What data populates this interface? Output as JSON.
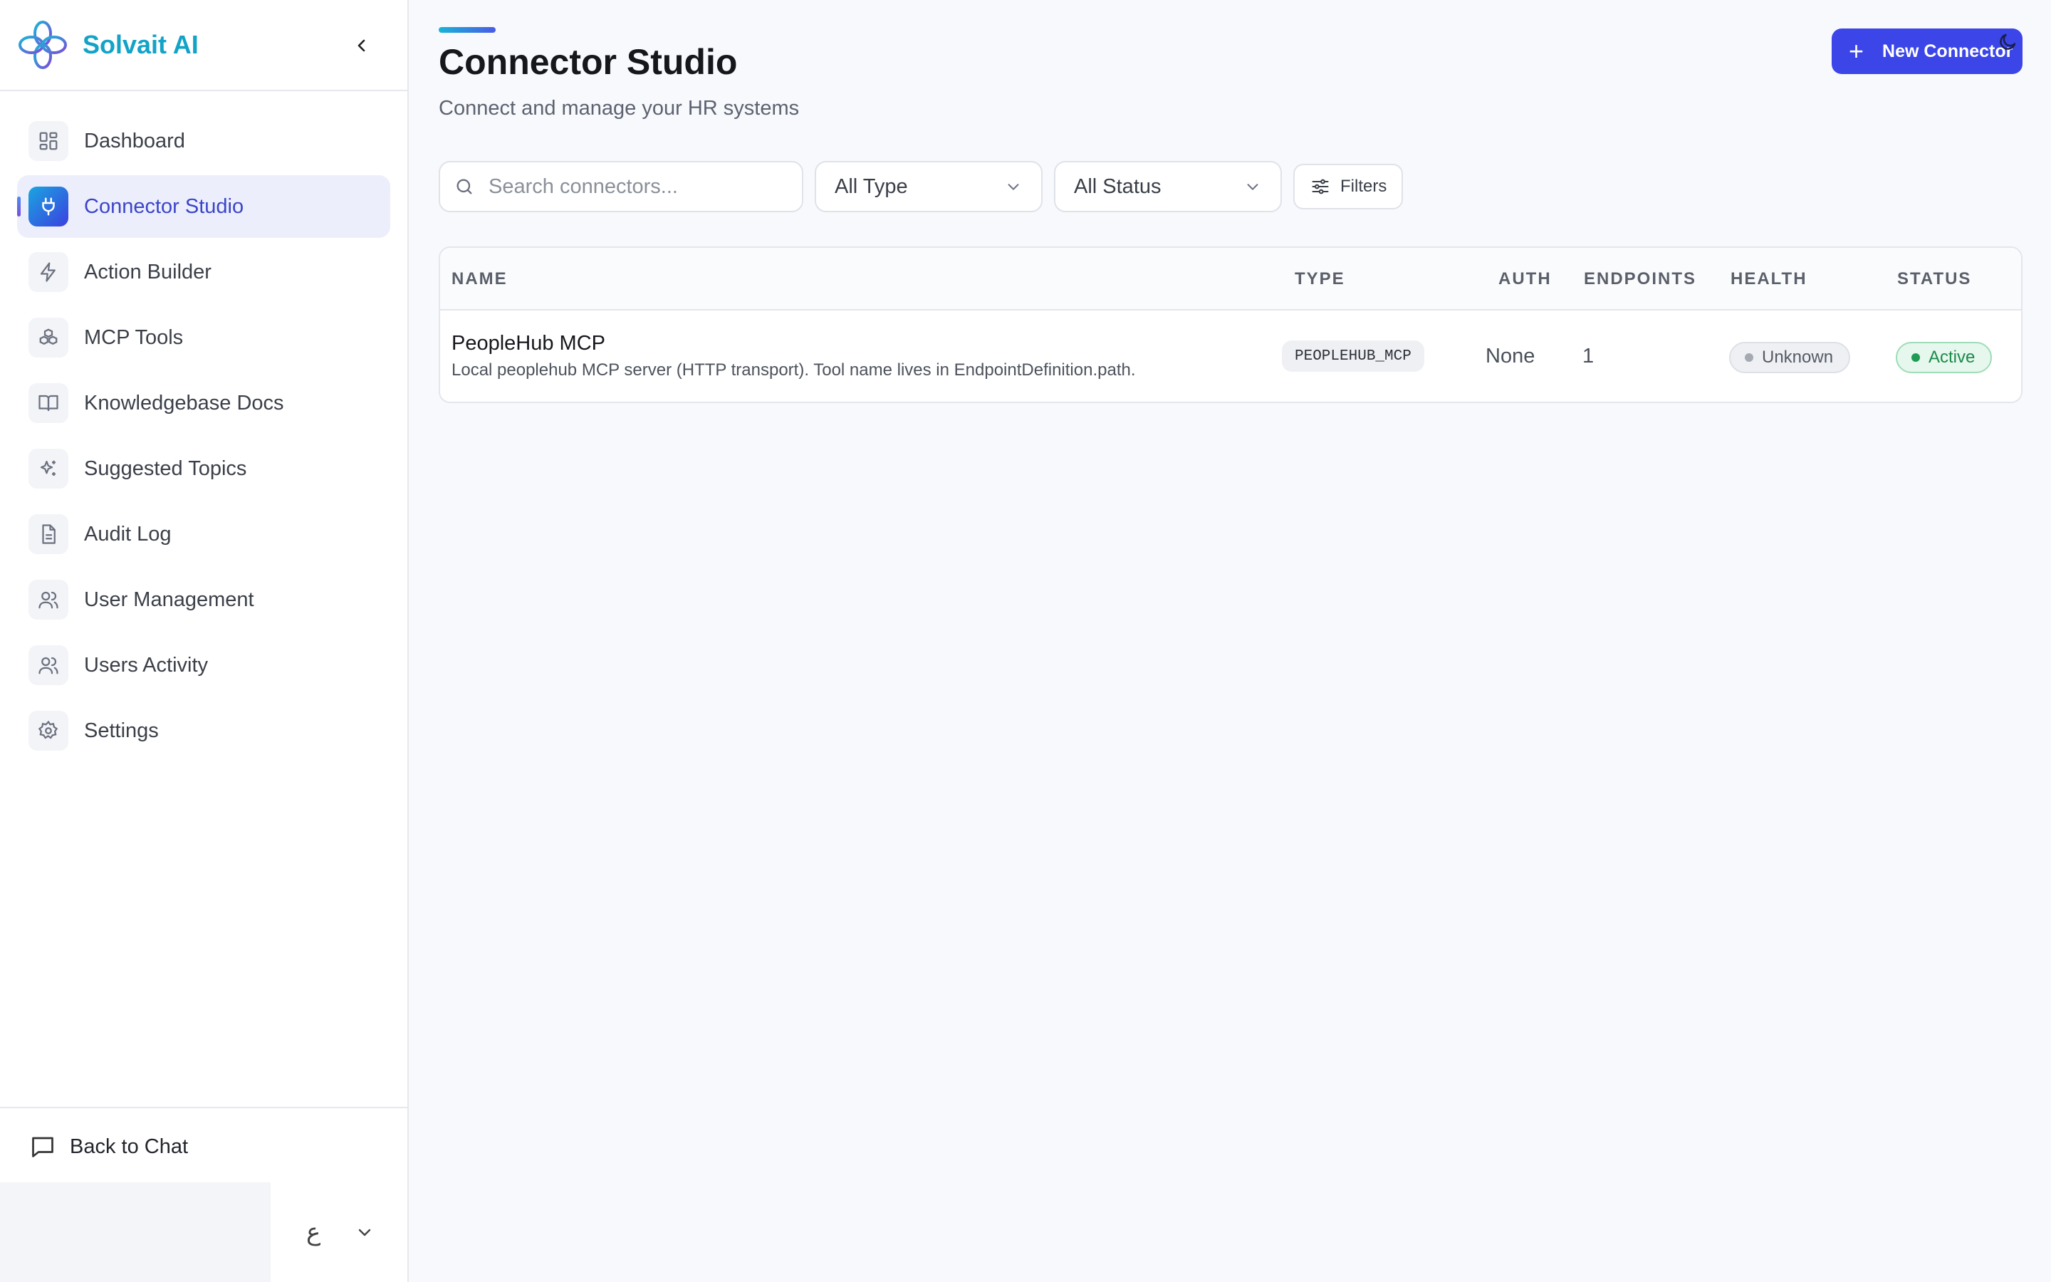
{
  "brand": {
    "name": "Solvait AI"
  },
  "sidebar": {
    "items": [
      {
        "label": "Dashboard",
        "icon": "dashboard-icon"
      },
      {
        "label": "Connector Studio",
        "icon": "plug-icon",
        "active": true
      },
      {
        "label": "Action Builder",
        "icon": "lightning-icon"
      },
      {
        "label": "MCP Tools",
        "icon": "cubes-icon"
      },
      {
        "label": "Knowledgebase Docs",
        "icon": "book-icon"
      },
      {
        "label": "Suggested Topics",
        "icon": "sparkles-icon"
      },
      {
        "label": "Audit Log",
        "icon": "document-icon"
      },
      {
        "label": "User Management",
        "icon": "users-icon"
      },
      {
        "label": "Users Activity",
        "icon": "users-icon"
      },
      {
        "label": "Settings",
        "icon": "gear-icon"
      }
    ],
    "back_to_chat": "Back to Chat",
    "language_glyph": "ع"
  },
  "header": {
    "title": "Connector Studio",
    "subtitle": "Connect and manage your HR systems",
    "new_button": "New Connector"
  },
  "filters": {
    "search_placeholder": "Search connectors...",
    "type_select": "All Type",
    "status_select": "All Status",
    "filters_button": "Filters"
  },
  "table": {
    "columns": [
      "NAME",
      "TYPE",
      "AUTH",
      "ENDPOINTS",
      "HEALTH",
      "STATUS"
    ],
    "rows": [
      {
        "name": "PeopleHub MCP",
        "description": "Local peoplehub MCP server (HTTP transport). Tool name lives in EndpointDefinition.path.",
        "type": "PEOPLEHUB_MCP",
        "auth": "None",
        "endpoints": "1",
        "health": "Unknown",
        "status": "Active"
      }
    ]
  },
  "colors": {
    "accent": "#3b45e8",
    "brand": "#12a3c7",
    "active_status": "#1f9b53",
    "unknown_status": "#a5a9b1"
  }
}
